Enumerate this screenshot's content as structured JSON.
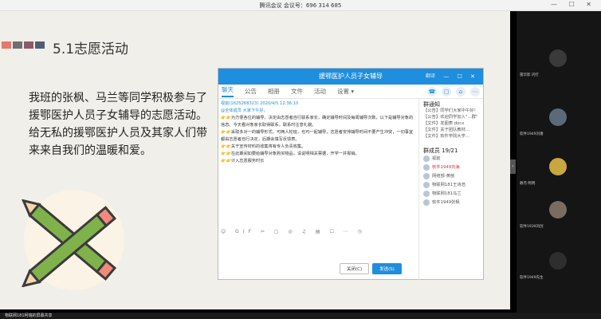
{
  "window": {
    "title": "腾讯会议 会议号：696 314 685",
    "controls": "— ☐ ✕"
  },
  "slide": {
    "title": "5.1志愿活动",
    "block_colors": [
      "#e8776e",
      "#6f6f6f",
      "#8d5a6b",
      "#4e5f73"
    ],
    "paragraph": "我班的张枫、马兰等同学积极参与了援鄂医护人员子女辅导的志愿活动。给无私的援鄂医护人员及其家人们带来来自我们的温暖和爱。"
  },
  "group_window": {
    "title": "援鄂医护人员子女辅导",
    "pin_label": "翻译",
    "controls": "— ☐ ✕",
    "tabs": [
      "聊天",
      "公告",
      "相册",
      "文件",
      "活动",
      "设置 ▾"
    ],
    "tab_icons": [
      "☎",
      "▢",
      "⌂",
      "⋯"
    ],
    "messages": [
      {
        "sender": "视前(1625268323) 2020/4/5 12:36:10",
        "kind": "header"
      },
      {
        "text": "@全体成员 大家下午好，",
        "kind": "mention"
      },
      {
        "text": "为方便各位的辅导，决定由志愿者自行联系家长，确定辅导时间及每周辅导次数，以下是辅导对象的信息。今天看对象家长取得联系，联系时注意礼貌。",
        "kind": "emoji"
      },
      {
        "text": "采取多对一的辅导形式，可两人轮班，也可一起辅导，志愿者安排辅导时间不要产生冲突，一切事宜都由志愿者自行决定，后期会填写反馈表。",
        "kind": "emoji"
      },
      {
        "text": "关于宣传材料的收集将有专人负责收集。",
        "kind": "emoji"
      },
      {
        "text": "在此期间如要给辅导对象购买物品，请说明相关票据，开学一并报销。",
        "kind": "emoji"
      },
      {
        "text": "计入志愿服务时长",
        "kind": "emoji"
      }
    ],
    "toolbar": "☺ GIF ✂ ▢ ◎ ♫ ▤ ☐ ⋯  ◷",
    "buttons": {
      "close": "关闭(C)",
      "send": "发送(S)"
    },
    "notice_title": "群通知",
    "notices": [
      "【公告】同学们大家中午好！",
      "【公告】欢迎同学加入\"…群\"",
      "【文件】发图表.docx",
      "【文件】关于团队教材…",
      "【文件】软件学院大学…"
    ],
    "members_title": "群成员 19/21",
    "members": [
      {
        "name": "视前",
        "red": false
      },
      {
        "name": "软件1949刘海",
        "red": true
      },
      {
        "name": "网络部-黄刨",
        "red": false
      },
      {
        "name": "物联网181王诗浩",
        "red": false
      },
      {
        "name": "物联网181马兰",
        "red": false
      },
      {
        "name": "软件1949张枫",
        "red": false
      }
    ]
  },
  "video_tiles": [
    {
      "name": "雷华影 闪打",
      "color": "#3a3a3a"
    },
    {
      "name": "软件1949刘潘",
      "color": "#5a6a78"
    },
    {
      "name": "赖杰·熙明",
      "color": "#c8a640"
    },
    {
      "name": "软件1939刘创",
      "color": "#7a6c60"
    },
    {
      "name": "软件1949先生",
      "color": "#2e2e2e"
    }
  ],
  "share_banner": "物联网181柯瑞的屏幕共享"
}
